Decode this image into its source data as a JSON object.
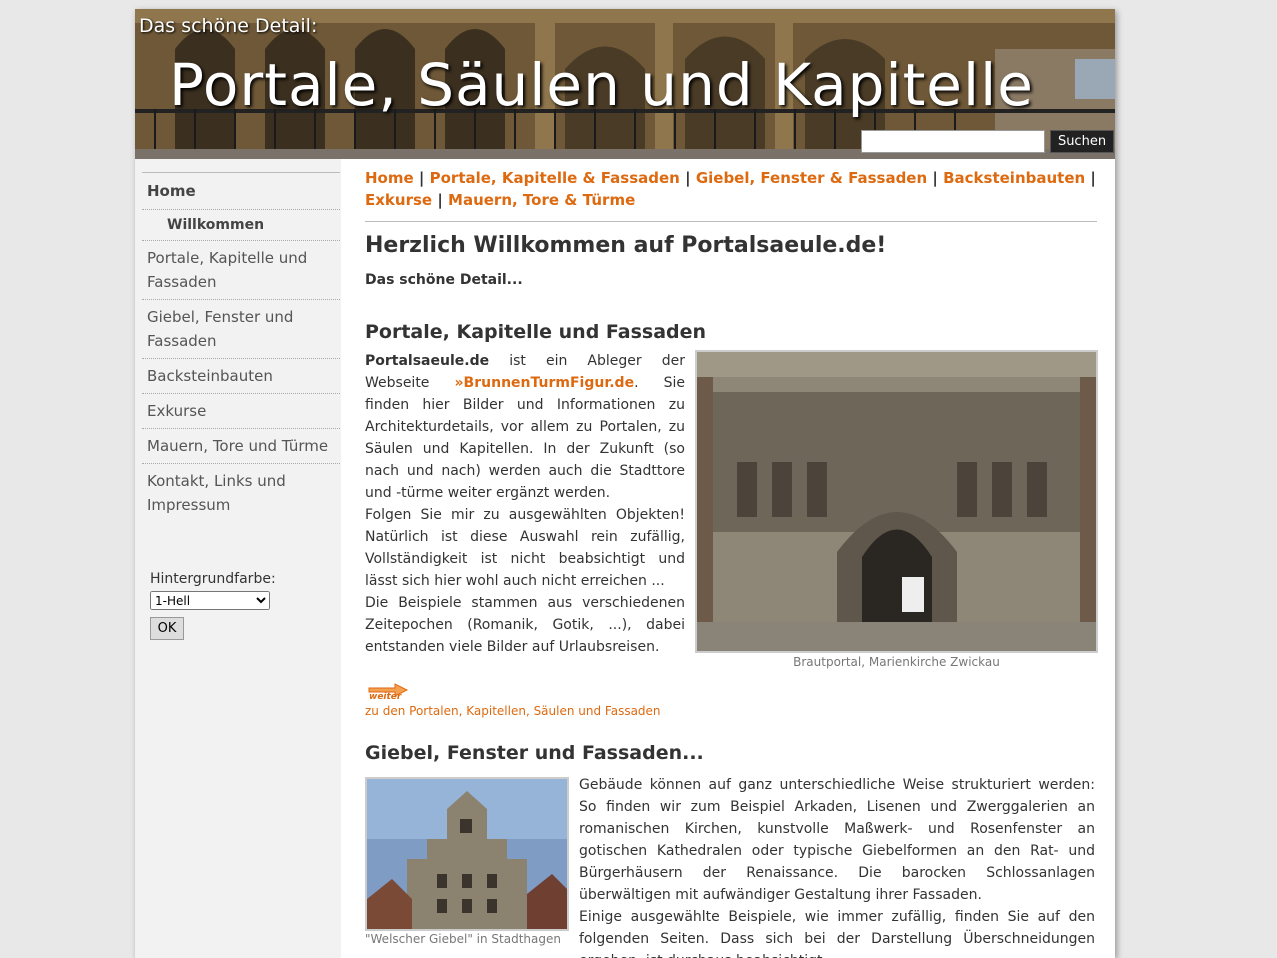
{
  "header": {
    "kicker": "Das schöne Detail:",
    "title": "Portale, Säulen und Kapitelle",
    "search_placeholder": "",
    "search_button": "Suchen"
  },
  "sidebar": {
    "items": [
      {
        "label": "Home"
      },
      {
        "label": "Willkommen"
      },
      {
        "label": "Portale, Kapitelle und Fassaden"
      },
      {
        "label": "Giebel, Fenster und Fassaden"
      },
      {
        "label": "Backsteinbauten"
      },
      {
        "label": "Exkurse"
      },
      {
        "label": "Mauern, Tore und Türme"
      },
      {
        "label": "Kontakt, Links und Impressum"
      }
    ],
    "bg_label": "Hintergrundfarbe:",
    "bg_selected": "1-Hell",
    "bg_ok": "OK"
  },
  "breadcrumb": {
    "items": [
      "Home",
      "Portale, Kapitelle & Fassaden",
      "Giebel, Fenster & Fassaden",
      "Backsteinbauten",
      "Exkurse",
      "Mauern, Tore & Türme"
    ],
    "separator": "|"
  },
  "main": {
    "heading": "Herzlich Willkommen auf Portalsaeule.de!",
    "subtitle": "Das schöne Detail...",
    "section1": {
      "heading": "Portale, Kapitelle und Fassaden",
      "site_name": "Portalsaeule.de",
      "text_a": " ist ein Ableger der Webseite ",
      "link": "»BrunnenTurmFigur.de",
      "text_b": ". Sie finden hier Bilder und Informationen zu Architekturdetails, vor allem zu Portalen, zu Säulen und Kapitellen. In der Zukunft (so nach und nach) werden auch die Stadttore und -türme weiter ergänzt werden.",
      "text_c": "Folgen Sie mir zu ausgewählten Objekten! Natürlich ist diese Auswahl rein zufällig, Vollständigkeit ist nicht beabsichtigt und lässt sich hier wohl auch nicht erreichen ...",
      "text_d": "Die Beispiele stammen aus verschiedenen Zeitepochen (Romanik, Gotik, ...), dabei entstanden viele Bilder auf Urlaubsreisen.",
      "image_caption": "Brautportal, Marienkirche Zwickau",
      "weiter_label": "weiter",
      "weiter_link": "zu den Portalen, Kapitellen, Säulen und Fassaden"
    },
    "section2": {
      "heading": "Giebel, Fenster und Fassaden...",
      "image_caption": "\"Welscher Giebel\" in Stadthagen",
      "text_a": "Gebäude können auf ganz unterschiedliche Weise strukturiert werden: So finden wir zum Beispiel Arkaden, Lisenen und Zwerggalerien an romanischen Kirchen, kunstvolle Maßwerk- und Rosenfenster an gotischen Kathedralen oder typische Giebelformen an den Rat- und Bürgerhäusern der Renaissance. Die barocken Schlossanlagen überwältigen mit aufwändiger Gestaltung ihrer Fassaden.",
      "text_b": "Einige ausgewählte Beispiele, wie immer zufällig, finden Sie auf den folgenden Seiten. Dass sich bei der Darstellung Überschneidungen ergeben, ist durchaus beabsichtigt."
    }
  },
  "colors": {
    "accent": "#dd6a10",
    "sidebar_bg": "#f2f2f2",
    "page_bg": "#e8e8e8"
  }
}
